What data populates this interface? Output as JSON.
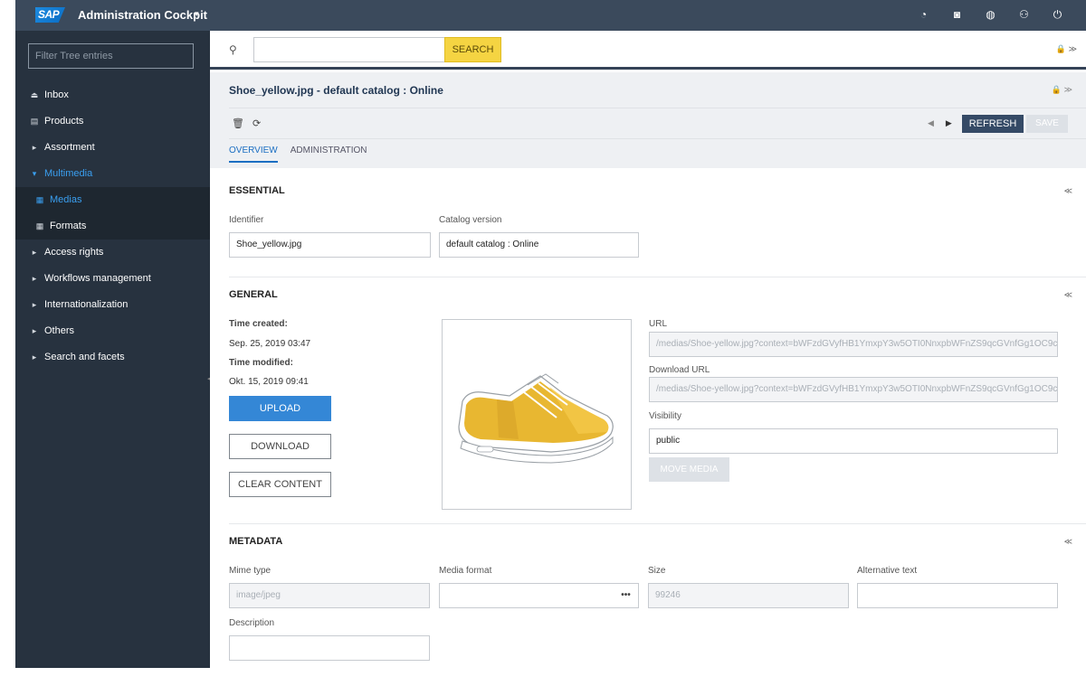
{
  "topbar": {
    "logo": "SAP",
    "title": "Administration Cockpit",
    "caret": "▾",
    "icons": [
      "help-icon",
      "notification-icon",
      "globe-icon",
      "user-settings-icon",
      "power-icon"
    ],
    "icon_glyphs": [
      "◔",
      "◙",
      "◍",
      "⚇",
      "⏻"
    ]
  },
  "sidebar": {
    "filter_placeholder": "Filter Tree entries",
    "items": [
      {
        "label": "Inbox",
        "icon": "⏏"
      },
      {
        "label": "Products",
        "icon": "▤"
      },
      {
        "label": "Assortment",
        "icon": "▸"
      },
      {
        "label": "Multimedia",
        "icon": "▾"
      },
      {
        "label": "Medias",
        "icon": "▦"
      },
      {
        "label": "Formats",
        "icon": "▦"
      },
      {
        "label": "Access rights",
        "icon": "▸"
      },
      {
        "label": "Workflows management",
        "icon": "▸"
      },
      {
        "label": "Internationalization",
        "icon": "▸"
      },
      {
        "label": "Others",
        "icon": "▸"
      },
      {
        "label": "Search and facets",
        "icon": "▸"
      }
    ]
  },
  "search": {
    "value": "",
    "button": "SEARCH",
    "right_icons": "🔒 ≫"
  },
  "editor": {
    "title": "Shoe_yellow.jpg - default catalog : Online",
    "lock_icons": "🔒 ≫",
    "toolbar_icons": [
      "🗑",
      "⟳"
    ],
    "refresh": "REFRESH",
    "save": "SAVE",
    "tabs": [
      "OVERVIEW",
      "ADMINISTRATION"
    ]
  },
  "essential": {
    "title": "ESSENTIAL",
    "identifier_label": "Identifier",
    "identifier": "Shoe_yellow.jpg",
    "catalog_label": "Catalog version",
    "catalog": "default catalog : Online"
  },
  "general": {
    "title": "GENERAL",
    "time_created_label": "Time created:",
    "time_created": "Sep. 25, 2019 03:47",
    "time_modified_label": "Time modified:",
    "time_modified": "Okt. 15, 2019 09:41",
    "upload": "UPLOAD",
    "download": "DOWNLOAD",
    "clear": "CLEAR CONTENT",
    "url_label": "URL",
    "url": "/medias/Shoe-yellow.jpg?context=bWFzdGVyfHB1YmxpY3w5OTI0NnxpbWFnZS9qcGVnfGg1OC9c",
    "download_url_label": "Download URL",
    "download_url": "/medias/Shoe-yellow.jpg?context=bWFzdGVyfHB1YmxpY3w5OTI0NnxpbWFnZS9qcGVnfGg1OC9c",
    "visibility_label": "Visibility",
    "visibility": "public",
    "move_media": "MOVE MEDIA"
  },
  "metadata": {
    "title": "METADATA",
    "mime_label": "Mime type",
    "mime": "image/jpeg",
    "format_label": "Media format",
    "format": "",
    "size_label": "Size",
    "size": "99246",
    "alt_label": "Alternative text",
    "alt": "",
    "description_label": "Description",
    "description": ""
  },
  "colors": {
    "topbar": "#3b4a5c",
    "sidebar": "#27323f",
    "accent": "#3487d6",
    "search_button": "#f5d442",
    "shoe_yellow": "#e8b731"
  }
}
